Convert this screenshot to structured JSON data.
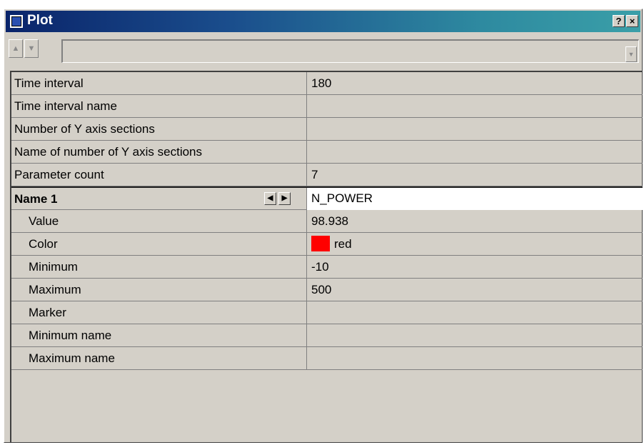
{
  "window": {
    "title": "Plot",
    "help_label": "?",
    "close_label": "×"
  },
  "toolbar": {
    "up_icon": "arrow-up-icon",
    "down_icon": "arrow-down-icon",
    "combo_value": "",
    "combo_icon": "dropdown-arrow-icon"
  },
  "properties": [
    {
      "name": "Time interval",
      "value": "180"
    },
    {
      "name": "Time interval name",
      "value": ""
    },
    {
      "name": "Number of Y axis sections",
      "value": ""
    },
    {
      "name": "Name of number of Y axis sections",
      "value": ""
    },
    {
      "name": "Parameter count",
      "value": "7"
    }
  ],
  "selected": {
    "name": "Name 1",
    "value": "N_POWER",
    "prev_icon": "arrow-left-icon",
    "next_icon": "arrow-right-icon"
  },
  "children": [
    {
      "name": "Value",
      "value": "98.938"
    },
    {
      "name": "Color",
      "value": "red",
      "swatch_color": "#ff0000"
    },
    {
      "name": "Minimum",
      "value": "-10"
    },
    {
      "name": "Maximum",
      "value": "500"
    },
    {
      "name": "Marker",
      "value": ""
    },
    {
      "name": "Minimum name",
      "value": ""
    },
    {
      "name": "Maximum name",
      "value": ""
    }
  ],
  "colors": {
    "titlebar_start": "#0a246a",
    "titlebar_end": "#3a9fa8",
    "face": "#d4d0c8"
  }
}
